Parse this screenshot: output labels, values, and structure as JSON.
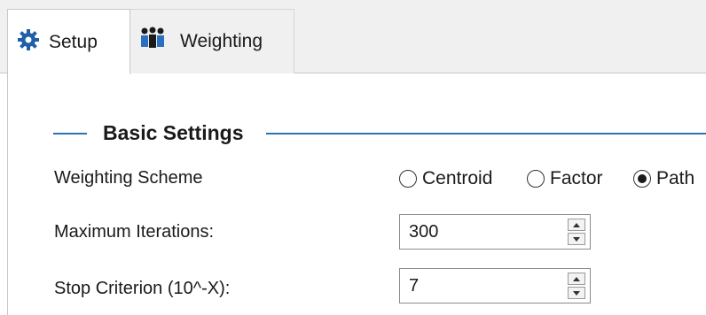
{
  "tabs": [
    {
      "label": "Setup",
      "icon": "gear-icon",
      "active": true
    },
    {
      "label": "Weighting",
      "icon": "people-icon",
      "active": false
    }
  ],
  "section": {
    "title": "Basic Settings"
  },
  "weighting_scheme": {
    "label": "Weighting Scheme",
    "options": [
      {
        "label": "Centroid",
        "selected": false
      },
      {
        "label": "Factor",
        "selected": false
      },
      {
        "label": "Path",
        "selected": true
      }
    ]
  },
  "max_iterations": {
    "label": "Maximum Iterations:",
    "value": "300"
  },
  "stop_criterion": {
    "label": "Stop Criterion (10^-X):",
    "value": "7"
  },
  "colors": {
    "accent": "#2a72b5",
    "gear": "#1f5fa8"
  }
}
